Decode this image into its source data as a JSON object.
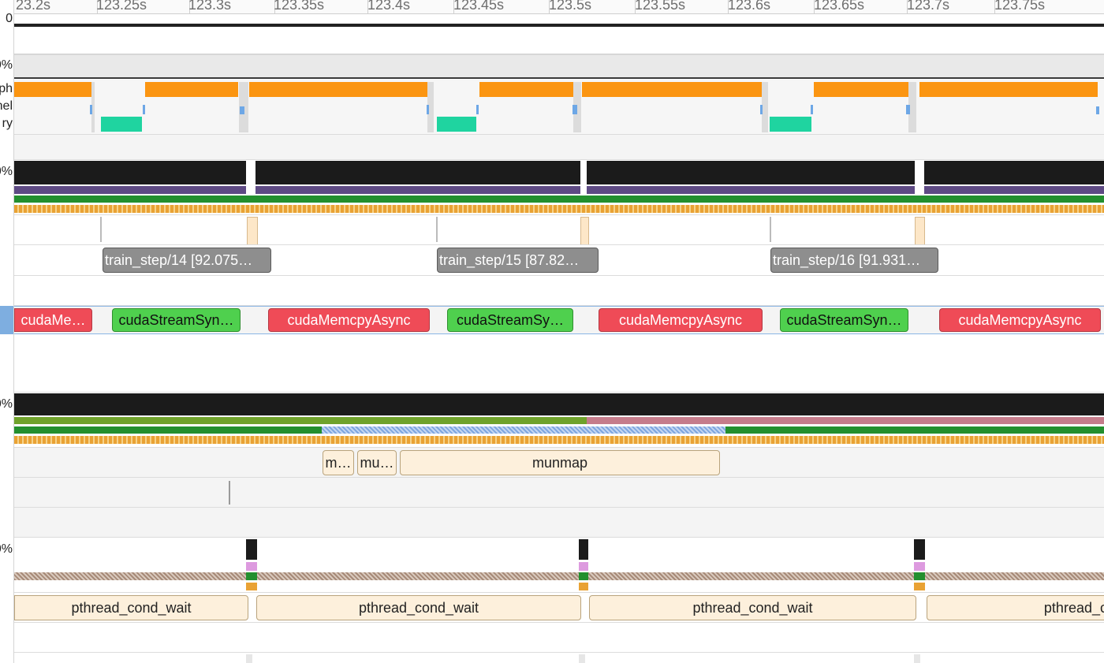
{
  "ruler": {
    "ticks": [
      "23.2s",
      "123.25s",
      "123.3s",
      "123.35s",
      "123.4s",
      "123.45s",
      "123.5s",
      "123.55s",
      "123.6s",
      "123.65s",
      "123.7s",
      "123.75s"
    ]
  },
  "gutter_labels": [
    "0",
    "0%",
    "ph",
    "nel",
    "ry",
    "0%",
    "0%",
    "0%"
  ],
  "train_steps": [
    "train_step/14 [92.075…",
    "train_step/15 [87.82…",
    "train_step/16 [91.931…"
  ],
  "cuda_slices": [
    "cudaMe…",
    "cudaStreamSyn…",
    "cudaMemcpyAsync",
    "cudaStreamSy…",
    "cudaMemcpyAsync",
    "cudaStreamSyn…",
    "cudaMemcpyAsync"
  ],
  "munmap_slices": [
    "m…",
    "mu…",
    "munmap"
  ],
  "pthread_slices": [
    "pthread_cond_wait",
    "pthread_cond_wait",
    "pthread_cond_wait",
    "pthread_co"
  ],
  "colors": {
    "orange": "#fb9511",
    "teal": "#1fd4a0",
    "cuda_red": "#ef4b57",
    "cuda_green": "#4fd04e",
    "track_black": "#1b1b1b",
    "purple": "#5e4a84",
    "dark_green": "#238f2e",
    "olive": "#6fa22b",
    "pink": "#c57c8b"
  }
}
